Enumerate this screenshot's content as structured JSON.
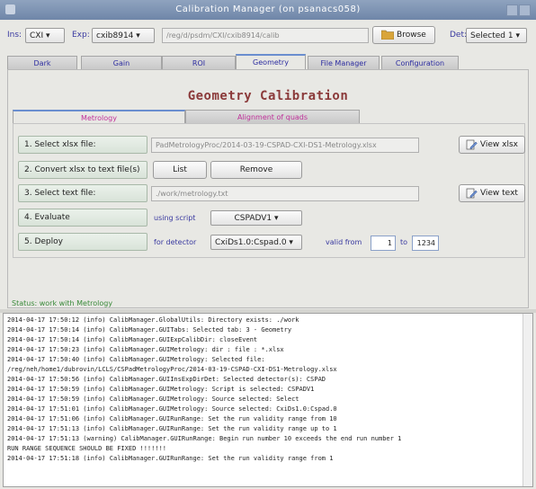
{
  "window": {
    "title": "Calibration Manager (on psanacs058)"
  },
  "toolbar": {
    "ins_label": "Ins:",
    "ins_value": "CXI ▾",
    "exp_label": "Exp:",
    "exp_value": "cxib8914 ▾",
    "path": "/reg/d/psdm/CXI/cxib8914/calib",
    "browse_label": "Browse",
    "det_label": "Det:",
    "det_value": "Selected 1 ▾"
  },
  "tabs": [
    "Dark",
    "Gain",
    "ROI",
    "Geometry",
    "File Manager",
    "Configuration"
  ],
  "active_tab": "Geometry",
  "heading": "Geometry Calibration",
  "subtabs": [
    "Metrology",
    "Alignment of quads"
  ],
  "steps": {
    "s1_label": "1. Select xlsx file:",
    "s1_path": "PadMetrologyProc/2014-03-19-CSPAD-CXI-DS1-Metrology.xlsx",
    "view_xlsx": "View xlsx",
    "s2_label": "2. Convert xlsx to text file(s)",
    "list": "List",
    "remove": "Remove",
    "s3_label": "3. Select text file:",
    "s3_path": "./work/metrology.txt",
    "view_text": "View text",
    "s4_label": "4. Evaluate",
    "using_script": "using script",
    "script_value": "CSPADV1 ▾",
    "s5_label": "5. Deploy",
    "for_detector": "for detector",
    "detector_value": "CxiDs1.0:Cspad.0 ▾",
    "valid_from": "valid from",
    "run_from": "1",
    "to": "to",
    "run_to": "1234"
  },
  "status": "Status: work with Metrology",
  "log_lines": [
    "2014-04-17 17:50:12 (info) CalibManager.GlobalUtils: Directory exists: ./work",
    "2014-04-17 17:50:14 (info) CalibManager.GUITabs: Selected tab: 3 - Geometry",
    "2014-04-17 17:50:14 (info) CalibManager.GUIExpCalibDir: closeEvent",
    "2014-04-17 17:50:23 (info) CalibManager.GUIMetrology: dir :     file : *.xlsx",
    "2014-04-17 17:50:40 (info) CalibManager.GUIMetrology: Selected file:",
    "/reg/neh/home1/dubrovin/LCLS/CSPadMetrologyProc/2014-03-19-CSPAD-CXI-DS1-Metrology.xlsx",
    "2014-04-17 17:50:56 (info) CalibManager.GUIInsExpDirDet: Selected detector(s): CSPAD",
    "2014-04-17 17:50:59 (info) CalibManager.GUIMetrology: Script is selected: CSPADV1",
    "2014-04-17 17:50:59 (info) CalibManager.GUIMetrology: Source selected: Select",
    "2014-04-17 17:51:01 (info) CalibManager.GUIMetrology: Source selected: CxiDs1.0:Cspad.0",
    "2014-04-17 17:51:06 (info) CalibManager.GUIRunRange: Set the run validity range from 10",
    "2014-04-17 17:51:13 (info) CalibManager.GUIRunRange: Set the run validity range up to 1",
    "2014-04-17 17:51:13 (warning) CalibManager.GUIRunRange: Begin run number 10 exceeds the end run number 1",
    "RUN RANGE SEQUENCE SHOULD BE FIXED !!!!!!!",
    "2014-04-17 17:51:18 (info) CalibManager.GUIRunRange: Set the run validity range from 1"
  ]
}
